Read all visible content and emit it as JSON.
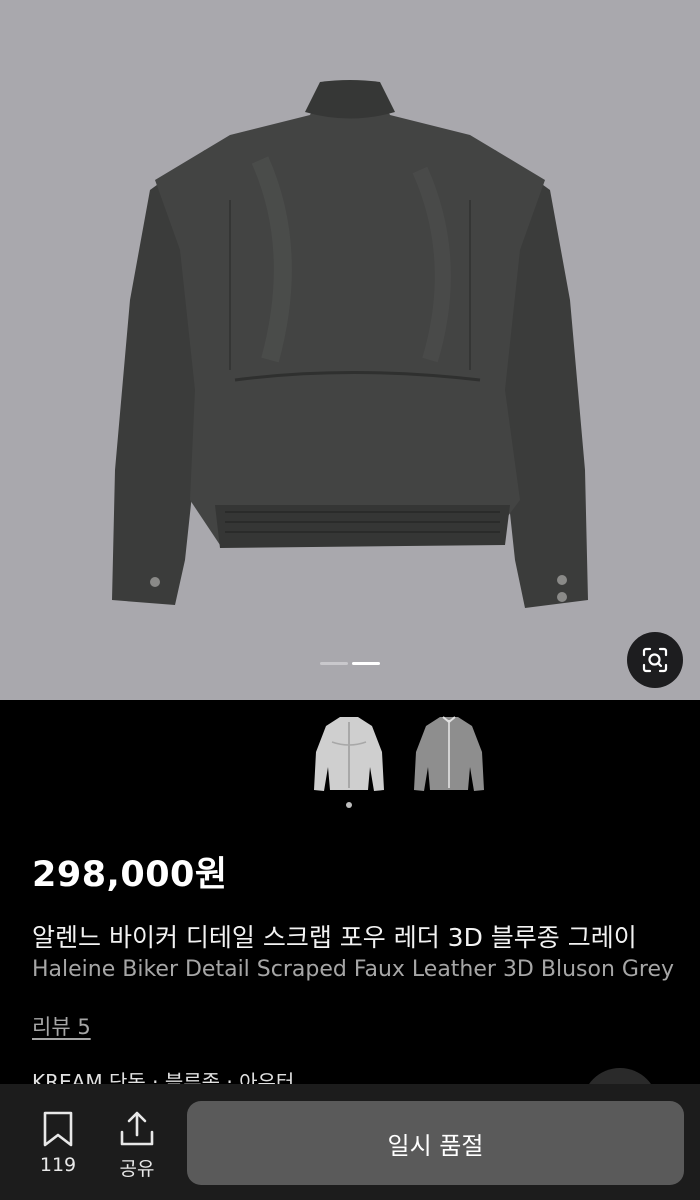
{
  "product": {
    "price": "298,000원",
    "title_ko": "알렌느 바이커 디테일 스크랩 포우 레더 3D 블루종 그레이",
    "title_en": "Haleine Biker Detail Scraped Faux Leather 3D Bluson Grey",
    "reviews_label": "리뷰 5",
    "category": "KREAM 단독 · 블루종 · 아우터"
  },
  "gallery": {
    "image_count": 2,
    "active_index": 1,
    "thumbnail_active_index": 0
  },
  "bottom_bar": {
    "bookmark_count": "119",
    "share_label": "공유",
    "buy_label": "일시 품절"
  },
  "colors": {
    "hero_background": "#a9a8ad",
    "page_background": "#000000",
    "button_disabled": "#5a5a5a"
  },
  "icons": [
    "lens-search-icon",
    "bookmark-icon",
    "share-icon"
  ]
}
